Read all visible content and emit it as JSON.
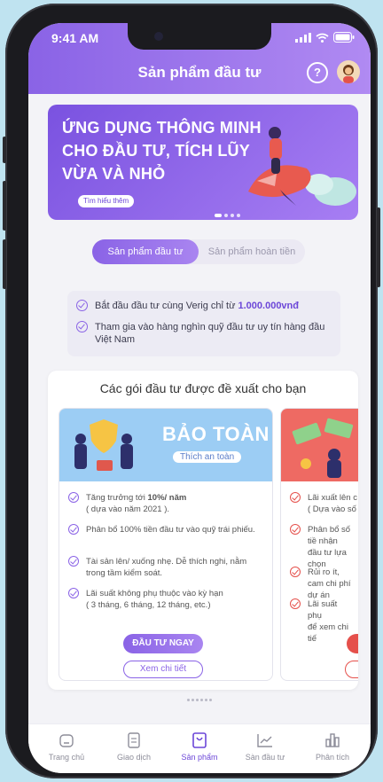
{
  "status_bar": {
    "time": "9:41 AM"
  },
  "header": {
    "title": "Sản phẩm đầu tư",
    "help_label": "?"
  },
  "banner": {
    "lines": [
      "ỨNG DỤNG THÔNG MINH",
      "CHO ĐẦU TƯ, TÍCH LŨY",
      "VỪA VÀ NHỎ"
    ],
    "button_label": "Tìm hiểu thêm"
  },
  "tabs": [
    {
      "label": "Sản phẩm đầu tư",
      "active": true
    },
    {
      "label": "Sản phẩm hoàn tiền",
      "active": false
    }
  ],
  "info": {
    "line1_prefix": "Bắt đầu đầu tư cùng Verig chỉ từ ",
    "line1_amount": "1.000.000vnđ",
    "line2": "Tham gia vào hàng nghìn quỹ đầu tư uy tín hàng đầu Việt Nam"
  },
  "packages": {
    "title": "Các gói đầu tư được đề xuất cho bạn",
    "cards": [
      {
        "name": "BẢO TOÀN",
        "tag": "Thích an toàn",
        "features": [
          {
            "text_prefix": "Tăng trưởng tới ",
            "text_bold": "10%/ năm",
            "note": "( dựa vào năm 2021 )."
          },
          {
            "text": "Phân bổ 100% tiền đầu tư vào quỹ trái phiếu."
          },
          {
            "text": "Tài sản lên/ xuống nhẹ. Dễ thích nghi, nằm trong tầm kiểm soát."
          },
          {
            "text": "Lãi suất không phụ thuộc vào kỳ hạn",
            "note": "( 3 tháng, 6 tháng, 12 tháng, etc.)"
          }
        ],
        "invest_label": "ĐẦU TƯ NGAY",
        "detail_label": "Xem chi tiết"
      },
      {
        "name": "",
        "tag": "",
        "features": [
          {
            "text": "Lãi xuất lên c",
            "note": "( Dựa vào số li"
          },
          {
            "text": "Phân bổ số tiề nhận đầu tư lựa chọn"
          },
          {
            "text": "Rủi ro ít, cam chi phí dự án"
          },
          {
            "text": "Lãi suất phụ",
            "note": "để xem chi tiế"
          }
        ],
        "invest_label": "ĐẦ",
        "detail_label": "Xe"
      }
    ]
  },
  "bottom_nav": [
    {
      "label": "Trang chủ",
      "icon": "home-icon",
      "active": false
    },
    {
      "label": "Giao dịch",
      "icon": "transactions-icon",
      "active": false
    },
    {
      "label": "Sản phẩm",
      "icon": "products-icon",
      "active": true
    },
    {
      "label": "Sàn đầu tư",
      "icon": "chart-icon",
      "active": false
    },
    {
      "label": "Phân tích",
      "icon": "analysis-icon",
      "active": false
    }
  ],
  "colors": {
    "primary": "#8a63e6",
    "accent": "#6c47d8",
    "card1_header": "#9ccdf4",
    "card2_header": "#ee6a63"
  }
}
